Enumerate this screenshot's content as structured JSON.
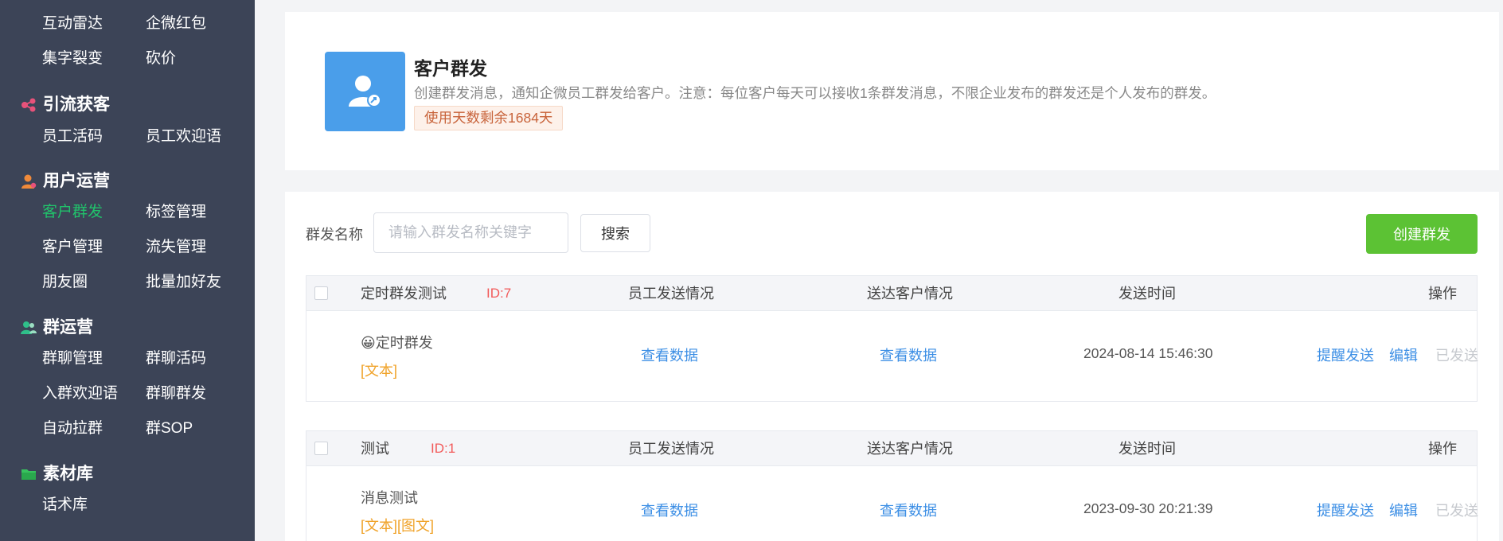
{
  "sidebar": {
    "rows": [
      [
        "互动雷达",
        "企微红包"
      ],
      [
        "集字裂变",
        "砍价"
      ]
    ],
    "sections": [
      {
        "title": "引流获客",
        "icon": "share-nodes-icon",
        "color": "#e8527a",
        "rows": [
          [
            "员工活码",
            "员工欢迎语"
          ]
        ]
      },
      {
        "title": "用户运营",
        "icon": "user-icon",
        "color": "#f08a3a",
        "rows": [
          [
            "客户群发",
            "标签管理"
          ],
          [
            "客户管理",
            "流失管理"
          ],
          [
            "朋友圈",
            "批量加好友"
          ]
        ]
      },
      {
        "title": "群运营",
        "icon": "group-icon",
        "color": "#2fbf8a",
        "rows": [
          [
            "群聊管理",
            "群聊活码"
          ],
          [
            "入群欢迎语",
            "群聊群发"
          ],
          [
            "自动拉群",
            "群SOP"
          ]
        ]
      },
      {
        "title": "素材库",
        "icon": "folder-icon",
        "color": "#37c25e",
        "rows": [
          [
            "话术库"
          ]
        ]
      }
    ],
    "active_item": "客户群发"
  },
  "header": {
    "title": "客户群发",
    "description": "创建群发消息，通知企微员工群发给客户。注意：每位客户每天可以接收1条群发消息，不限企业发布的群发还是个人发布的群发。",
    "badge": "使用天数剩余1684天",
    "icon": "user-share-icon"
  },
  "filter": {
    "label": "群发名称",
    "placeholder": "请输入群发名称关键字",
    "search_label": "搜索",
    "create_label": "创建群发"
  },
  "columns": {
    "staff": "员工发送情况",
    "customer": "送达客户情况",
    "time": "发送时间",
    "ops": "操作"
  },
  "records": [
    {
      "name": "定时群发测试",
      "id": "ID:7",
      "message": "定时群发",
      "message_emoji": "😀",
      "tags": "[文本]",
      "staff_link": "查看数据",
      "customer_link": "查看数据",
      "time": "2024-08-14 15:46:30",
      "actions": {
        "remind": "提醒发送",
        "edit": "编辑",
        "sent": "已发送"
      }
    },
    {
      "name": "测试",
      "id": "ID:1",
      "message": "消息测试",
      "message_emoji": "",
      "tags": "[文本][图文]",
      "staff_link": "查看数据",
      "customer_link": "查看数据",
      "time": "2023-09-30 20:21:39",
      "actions": {
        "remind": "提醒发送",
        "edit": "编辑",
        "sent": "已发送"
      }
    }
  ]
}
